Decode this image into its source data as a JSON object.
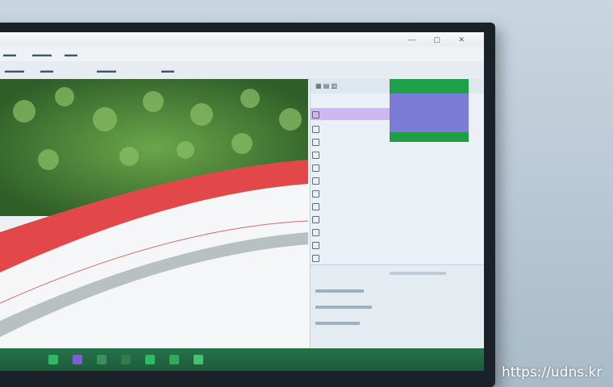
{
  "watermark": "https://udns.kr",
  "colors": {
    "accent_green": "#21a04a",
    "accent_purple": "#7c7cd6",
    "highlight_row": "#cdb9ef",
    "taskbar": "#1c5c3b",
    "red_curve": "#e2474a"
  },
  "icons": [
    "window-controls-icon",
    "spreadsheet-icon",
    "taskbar-app-icon"
  ]
}
